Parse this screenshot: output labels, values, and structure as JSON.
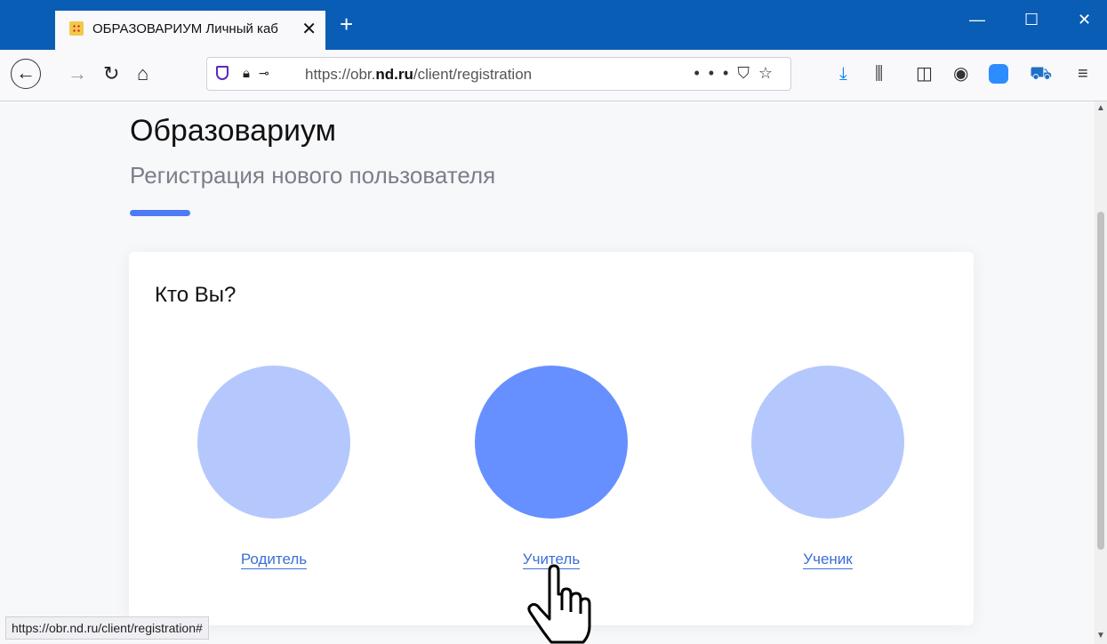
{
  "browser": {
    "tab_title": "ОБРАЗОВАРИУМ Личный каб",
    "tab_close": "✕",
    "new_tab": "+",
    "url_prefix": "https://obr.",
    "url_domain": "nd.ru",
    "url_path": "/client/registration",
    "url_actions": "•••⛉☆",
    "status_url": "https://obr.nd.ru/client/registration#"
  },
  "page": {
    "title": "Образовариум",
    "subtitle": "Регистрация нового пользователя"
  },
  "card": {
    "question": "Кто Вы?",
    "roles": [
      {
        "label": "Родитель",
        "active": false
      },
      {
        "label": "Учитель",
        "active": true
      },
      {
        "label": "Ученик",
        "active": false
      }
    ]
  },
  "colors": {
    "titlebar": "#0a5db5",
    "accent": "#4b7bf5",
    "circle": "#b5c8fd",
    "circle_active": "#6690ff",
    "link": "#3b6fd6"
  }
}
